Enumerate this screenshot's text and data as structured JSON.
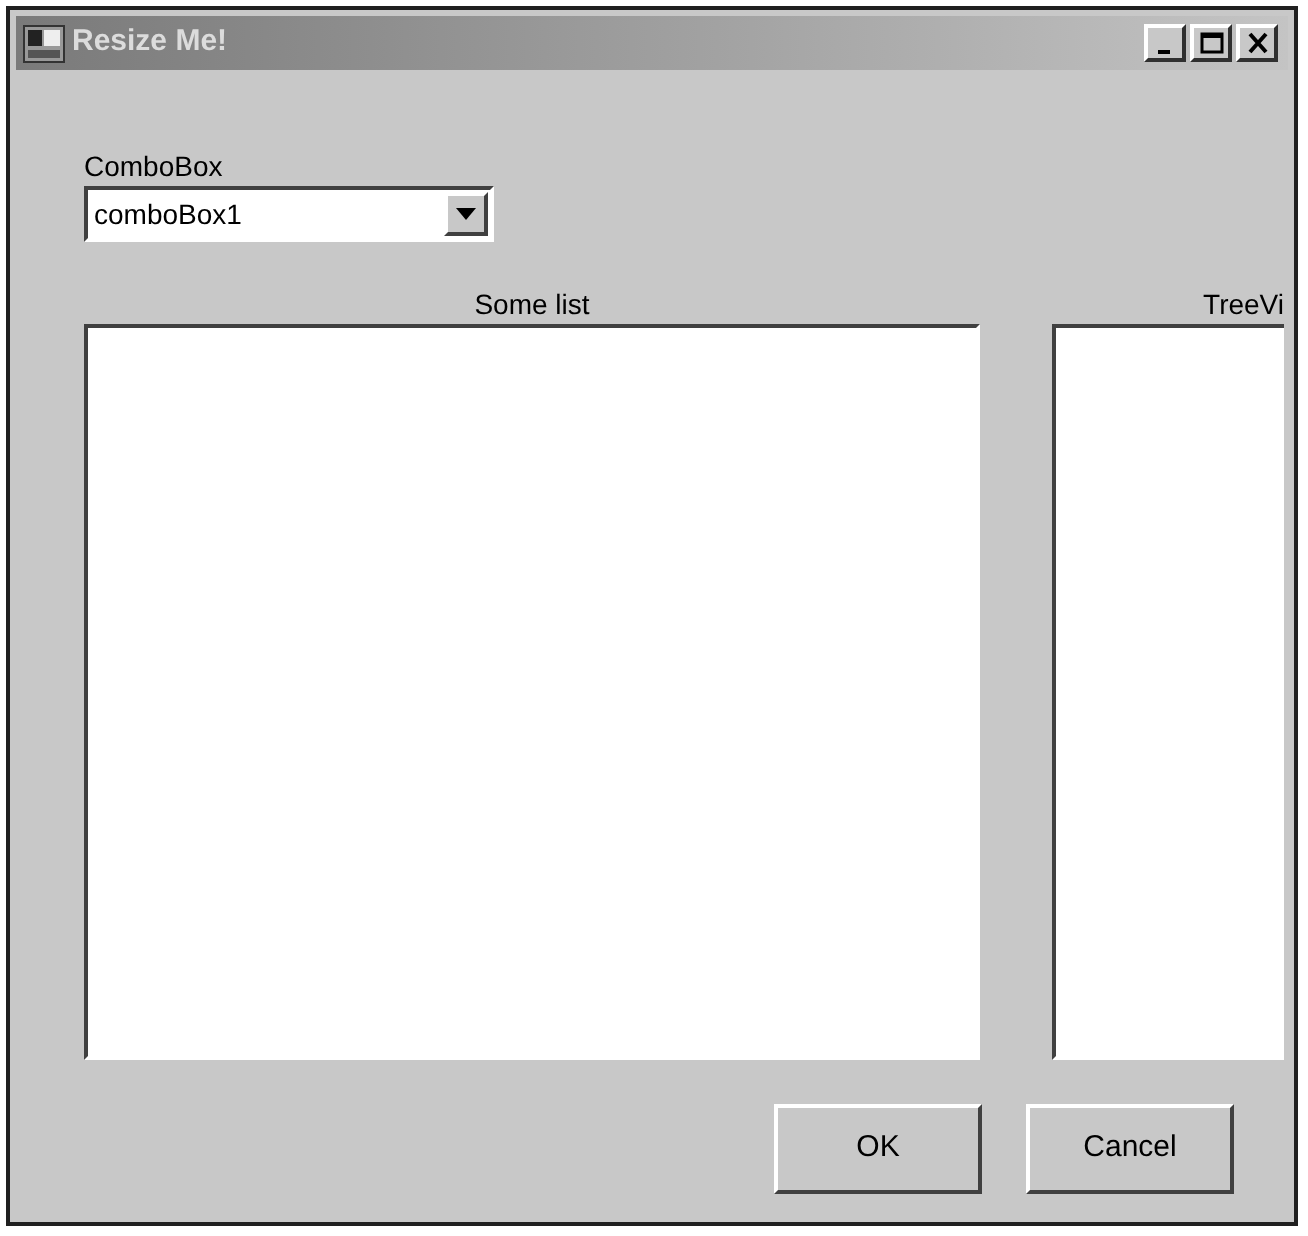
{
  "window": {
    "title": "Resize Me!",
    "controls": [
      {
        "kind": "minimize"
      },
      {
        "kind": "maximize"
      },
      {
        "kind": "close"
      }
    ]
  },
  "combo": {
    "label": "ComboBox",
    "value": "comboBox1"
  },
  "lists": [
    {
      "label": "Some list"
    },
    {
      "label": "TreeVi"
    }
  ],
  "buttons": [
    "OK",
    "Cancel"
  ]
}
